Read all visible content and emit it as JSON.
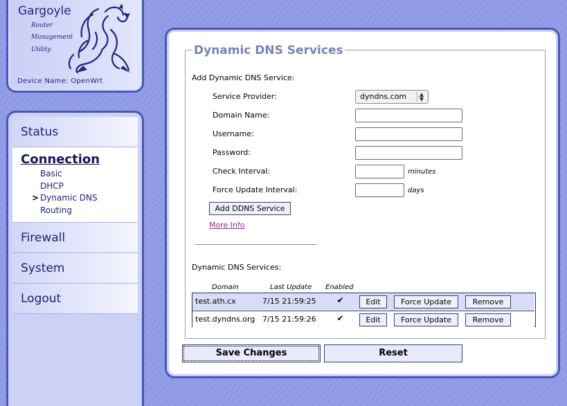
{
  "logo": {
    "title": "Gargoyle",
    "subtitle_lines": [
      "Router",
      "Management",
      "Utility"
    ],
    "device_name": "Device Name: OpenWrt"
  },
  "nav": {
    "items": [
      {
        "label": "Status"
      },
      {
        "label": "Connection",
        "active": true
      },
      {
        "label": "Firewall"
      },
      {
        "label": "System"
      },
      {
        "label": "Logout"
      }
    ],
    "sub_items": [
      {
        "label": "Basic"
      },
      {
        "label": "DHCP"
      },
      {
        "label": "Dynamic DNS",
        "selected": true
      },
      {
        "label": "Routing"
      }
    ]
  },
  "section": {
    "title": "Dynamic DNS Services",
    "add_heading": "Add Dynamic DNS Service:",
    "fields": {
      "provider_label": "Service Provider:",
      "provider_value": "dyndns.com",
      "domain_label": "Domain Name:",
      "domain_value": "",
      "username_label": "Username:",
      "username_value": "",
      "password_label": "Password:",
      "password_value": "",
      "check_label": "Check Interval:",
      "check_value": "",
      "check_unit": "minutes",
      "force_label": "Force Update Interval:",
      "force_value": "",
      "force_unit": "days"
    },
    "add_button": "Add DDNS Service",
    "more_info": "More Info",
    "list_heading": "Dynamic DNS Services:",
    "table": {
      "headers": [
        "Domain",
        "Last Update",
        "Enabled"
      ],
      "rows": [
        {
          "domain": "test.ath.cx",
          "last_update": "7/15 21:59:25",
          "enabled": true
        },
        {
          "domain": "test.dyndns.org",
          "last_update": "7/15 21:59:26",
          "enabled": true
        }
      ],
      "row_buttons": {
        "edit": "Edit",
        "force": "Force Update",
        "remove": "Remove"
      }
    }
  },
  "actions": {
    "save": "Save Changes",
    "reset": "Reset"
  },
  "colors": {
    "background": "#8f9ae6",
    "panel_border": "#4a56b8",
    "legend": "#7b82b6",
    "nav_text": "#1b2275"
  }
}
